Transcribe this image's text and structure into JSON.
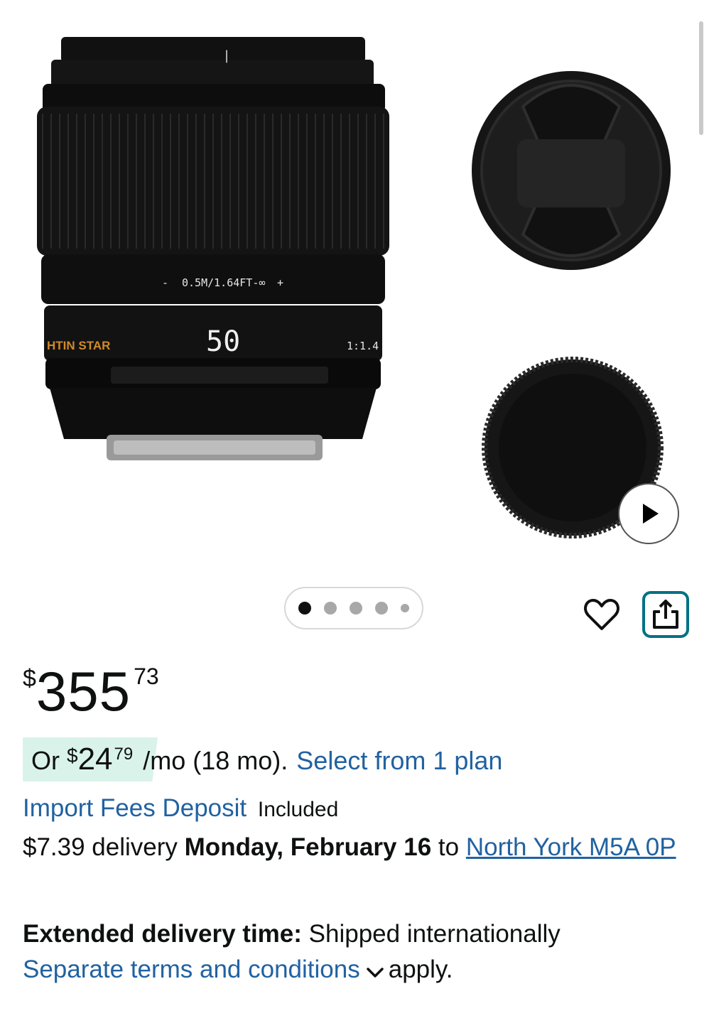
{
  "gallery": {
    "lens_focus_scale": "0.5M/1.64FT-∞",
    "lens_focal_length": "50",
    "lens_brand": "HTIN STAR",
    "lens_aperture": "1:1.4",
    "slide_count": 5,
    "active_slide": 1
  },
  "price": {
    "currency": "$",
    "whole": "355",
    "fraction": "73"
  },
  "installment": {
    "prefix": "Or",
    "currency": "$",
    "whole": "24",
    "fraction": "79",
    "suffix": "/mo (18 mo).",
    "link": "Select from 1 plan"
  },
  "import_fees": {
    "link": "Import Fees Deposit",
    "status": "Included"
  },
  "delivery": {
    "cost": "$7.39 delivery",
    "date": "Monday, February 16",
    "to": "to",
    "location": "North York M5A 0P"
  },
  "extended": {
    "label": "Extended delivery time:",
    "text": "Shipped internationally",
    "terms_link": "Separate terms and conditions",
    "apply": "apply."
  },
  "colors": {
    "link": "#2162a1",
    "share_border": "#007185",
    "badge_bg": "#d9f3ea"
  }
}
